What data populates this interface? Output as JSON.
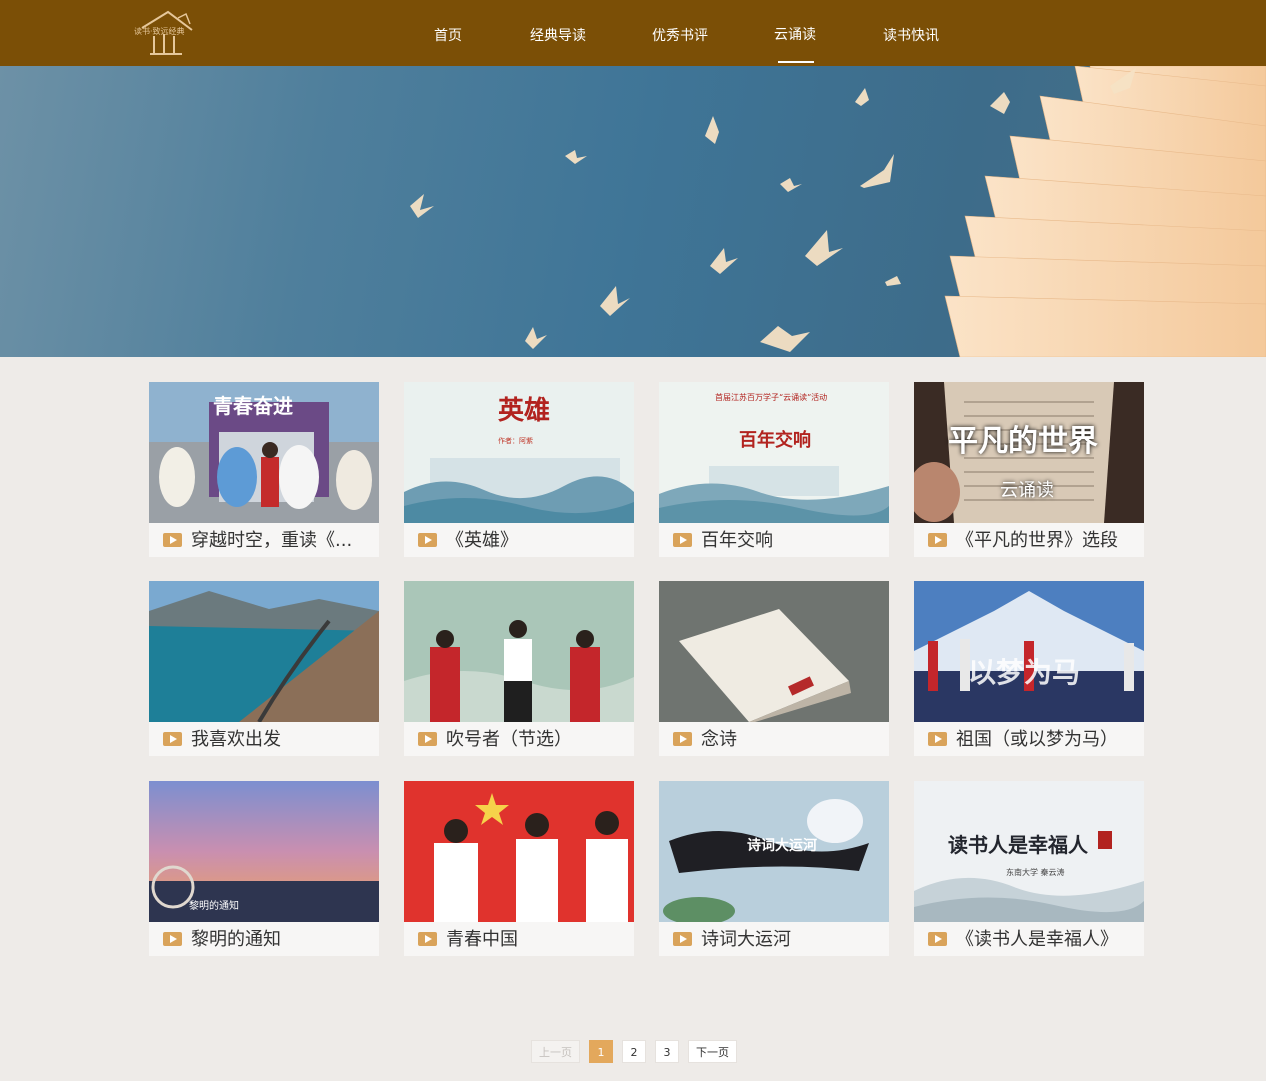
{
  "header": {
    "logo_text": "读书·致远经典",
    "nav": [
      {
        "label": "首页"
      },
      {
        "label": "经典导读"
      },
      {
        "label": "优秀书评"
      },
      {
        "label": "云诵读",
        "active": true
      },
      {
        "label": "读书快讯"
      }
    ]
  },
  "videos": [
    {
      "title": "穿越时空，重读《...",
      "thumb_text": "青春奋进"
    },
    {
      "title": "《英雄》",
      "thumb_text": "英雄",
      "thumb_sub": "作者：阿紫"
    },
    {
      "title": "百年交响",
      "thumb_text": "百年交响",
      "thumb_sub": "首届江苏百万学子“云诵读”活动"
    },
    {
      "title": "《平凡的世界》选段",
      "thumb_text": "平凡的世界",
      "thumb_sub": "云诵读"
    },
    {
      "title": "我喜欢出发"
    },
    {
      "title": "吹号者（节选）"
    },
    {
      "title": "念诗"
    },
    {
      "title": "祖国（或以梦为马）",
      "thumb_text": "以梦为马"
    },
    {
      "title": "黎明的通知",
      "thumb_text": "黎明的通知"
    },
    {
      "title": "青春中国"
    },
    {
      "title": "诗词大运河",
      "thumb_text": "诗词大运河"
    },
    {
      "title": "《读书人是幸福人》",
      "thumb_text": "读书人是幸福人",
      "thumb_sub": "东南大学 秦云涛"
    }
  ],
  "pagination": {
    "prev": "上一页",
    "pages": [
      "1",
      "2",
      "3"
    ],
    "current": "1",
    "next": "下一页"
  },
  "colors": {
    "header": "#7b4f06",
    "accent": "#e3a85c",
    "page_bg": "#eeebe8"
  }
}
